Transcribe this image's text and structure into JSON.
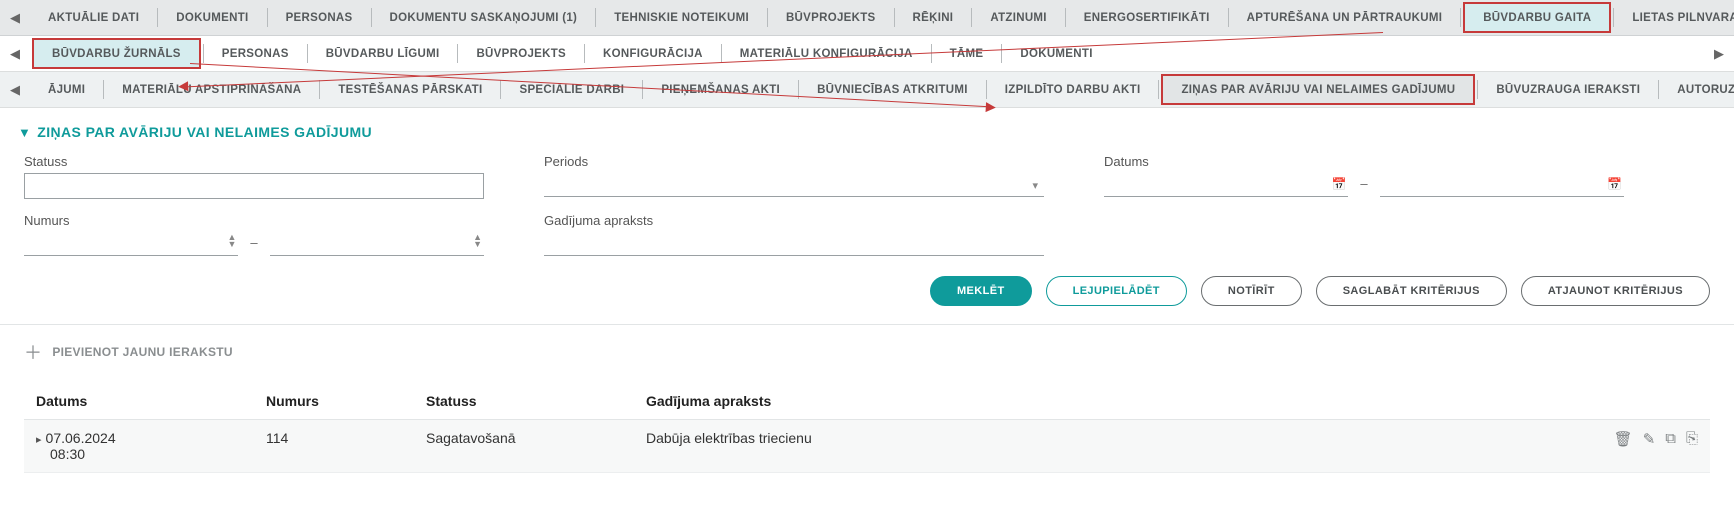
{
  "top_tabs": {
    "items": [
      "Aktuālie dati",
      "Dokumenti",
      "Personas",
      "Dokumentu saskaņojumi (1)",
      "Tehniskie noteikumi",
      "Būvprojekts",
      "Rēķini",
      "Atzinumi",
      "Energosertifikāti",
      "Apturēšana un pārtraukumi",
      "Būvdarbu gaita",
      "Lietas pilnvaras/dele"
    ],
    "active_index": 10
  },
  "mid_tabs": {
    "items": [
      "Būvdarbu žurnāls",
      "Personas",
      "Būvdarbu līgumi",
      "Būvprojekts",
      "Konfigurācija",
      "Materiālu konfigurācija",
      "Tāme",
      "Dokumenti"
    ],
    "active_index": 0
  },
  "sub_tabs": {
    "items": [
      "ājumi",
      "Materiālu apstiprināšana",
      "Testēšanas pārskati",
      "Speciālie darbi",
      "Pieņemšanas akti",
      "Būvniecības atkritumi",
      "Izpildīto darbu akti",
      "Ziņas par avāriju vai nelaimes gadījumu",
      "Būvuzrauga ieraksti",
      "Autoruzrauga ieraks"
    ],
    "active_index": 7
  },
  "section_title": "Ziņas par avāriju vai nelaimes gadījumu",
  "filters": {
    "status_label": "Statuss",
    "number_label": "Numurs",
    "period_label": "Periods",
    "desc_label": "Gadījuma apraksts",
    "date_label": "Datums"
  },
  "buttons": {
    "search": "Meklēt",
    "download": "Lejupielādēt",
    "clear": "Notīrīt",
    "save_criteria": "Saglabāt kritērijus",
    "restore_criteria": "Atjaunot kritērijus"
  },
  "add_label": "Pievienot jaunu ierakstu",
  "table": {
    "headers": {
      "date": "Datums",
      "number": "Numurs",
      "status": "Statuss",
      "desc": "Gadījuma apraksts"
    },
    "rows": [
      {
        "date": "07.06.2024",
        "time": "08:30",
        "number": "114",
        "status": "Sagatavošanā",
        "desc": "Dabūja elektrības triecienu"
      }
    ]
  }
}
